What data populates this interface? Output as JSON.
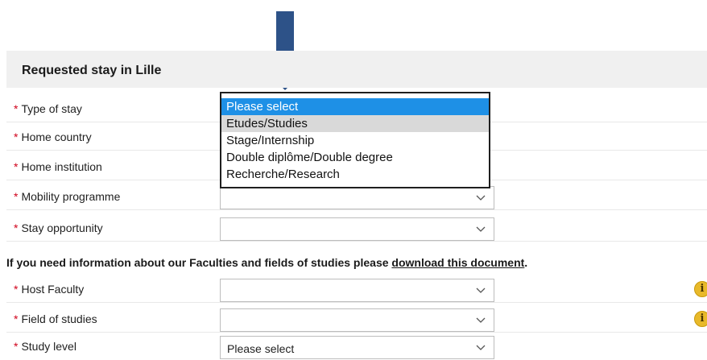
{
  "section": {
    "title": "Requested stay in Lille"
  },
  "required_marker": "*",
  "fields": {
    "type_of_stay": {
      "label": "Type of stay"
    },
    "home_country": {
      "label": "Home country"
    },
    "home_institution": {
      "label": "Home institution"
    },
    "mobility_programme": {
      "label": "Mobility programme",
      "value": ""
    },
    "stay_opportunity": {
      "label": "Stay opportunity",
      "value": ""
    },
    "host_faculty": {
      "label": "Host Faculty",
      "value": ""
    },
    "field_of_studies": {
      "label": "Field of studies",
      "value": ""
    },
    "study_level": {
      "label": "Study level",
      "value": "Please select"
    }
  },
  "dropdown": {
    "options": [
      "Please select",
      "Etudes/Studies",
      "Stage/Internship",
      "Double diplôme/Double degree",
      "Recherche/Research"
    ],
    "selected_index": 0,
    "hover_index": 1
  },
  "info": {
    "text": "If you need information about our Faculties and fields of studies please ",
    "link": "download this document",
    "suffix": "."
  },
  "icons": {
    "info": "i"
  },
  "colors": {
    "arrow": "#2d5288",
    "selected": "#1e90e6",
    "info_icon": "#e8b92a",
    "required": "#d0021b"
  }
}
